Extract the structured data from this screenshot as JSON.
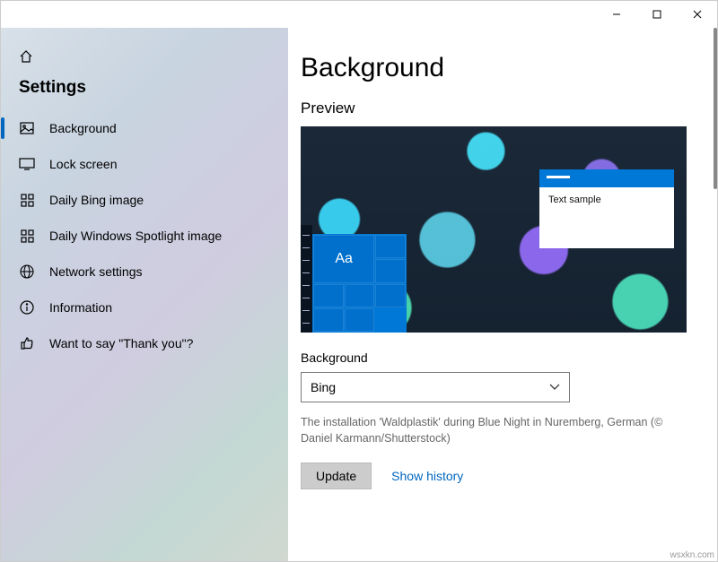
{
  "titlebar": {
    "min": "—",
    "max": "▢",
    "close": "✕"
  },
  "sidebar": {
    "title": "Settings",
    "items": [
      {
        "label": "Background",
        "icon": "picture-icon",
        "selected": true
      },
      {
        "label": "Lock screen",
        "icon": "monitor-icon",
        "selected": false
      },
      {
        "label": "Daily Bing image",
        "icon": "grid-icon",
        "selected": false
      },
      {
        "label": "Daily Windows Spotlight image",
        "icon": "grid-icon",
        "selected": false
      },
      {
        "label": "Network settings",
        "icon": "globe-icon",
        "selected": false
      },
      {
        "label": "Information",
        "icon": "info-icon",
        "selected": false
      },
      {
        "label": "Want to say \"Thank you\"?",
        "icon": "thumbsup-icon",
        "selected": false
      }
    ]
  },
  "main": {
    "heading": "Background",
    "preview_label": "Preview",
    "sample_text": "Text sample",
    "start_glyph": "Aa",
    "bg_field_label": "Background",
    "bg_select_value": "Bing",
    "caption": "The installation 'Waldplastik' during Blue Night in Nuremberg, German (© Daniel Karmann/Shutterstock)",
    "update_label": "Update",
    "history_label": "Show history"
  },
  "watermark": "wsxkn.com"
}
